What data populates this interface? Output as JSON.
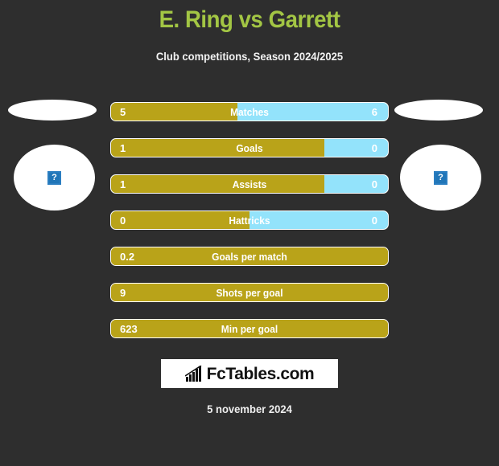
{
  "header": {
    "title": "E. Ring vs Garrett",
    "subtitle": "Club competitions, Season 2024/2025",
    "title_color": "#a3c644"
  },
  "players": {
    "home": {
      "photo_placeholder": "?"
    },
    "away": {
      "photo_placeholder": "?"
    }
  },
  "colors": {
    "background": "#2e2e2e",
    "home_bar": "#b9a319",
    "away_bar": "#93e3fb",
    "accent_green": "#a3c644",
    "text": "#ffffff"
  },
  "chart_data": {
    "type": "bar",
    "title": "E. Ring vs Garrett",
    "subtitle": "Club competitions, Season 2024/2025",
    "orientation": "horizontal-diverging",
    "series": [
      {
        "name": "E. Ring",
        "color": "#b9a319"
      },
      {
        "name": "Garrett",
        "color": "#93e3fb"
      }
    ],
    "categories": [
      "Matches",
      "Goals",
      "Assists",
      "Hattricks",
      "Goals per match",
      "Shots per goal",
      "Min per goal"
    ],
    "rows": [
      {
        "label": "Matches",
        "home": "5",
        "away": "6",
        "home_pct": 45.5,
        "split": true
      },
      {
        "label": "Goals",
        "home": "1",
        "away": "0",
        "home_pct": 77.0,
        "split": true
      },
      {
        "label": "Assists",
        "home": "1",
        "away": "0",
        "home_pct": 77.0,
        "split": true
      },
      {
        "label": "Hattricks",
        "home": "0",
        "away": "0",
        "home_pct": 50.0,
        "split": true
      },
      {
        "label": "Goals per match",
        "home": "0.2",
        "away": "",
        "home_pct": 100,
        "split": false
      },
      {
        "label": "Shots per goal",
        "home": "9",
        "away": "",
        "home_pct": 100,
        "split": false
      },
      {
        "label": "Min per goal",
        "home": "623",
        "away": "",
        "home_pct": 100,
        "split": false
      }
    ]
  },
  "footer": {
    "logo_text": "FcTables.com",
    "logo_icon": "bar-chart-trend-icon",
    "date": "5 november 2024"
  }
}
